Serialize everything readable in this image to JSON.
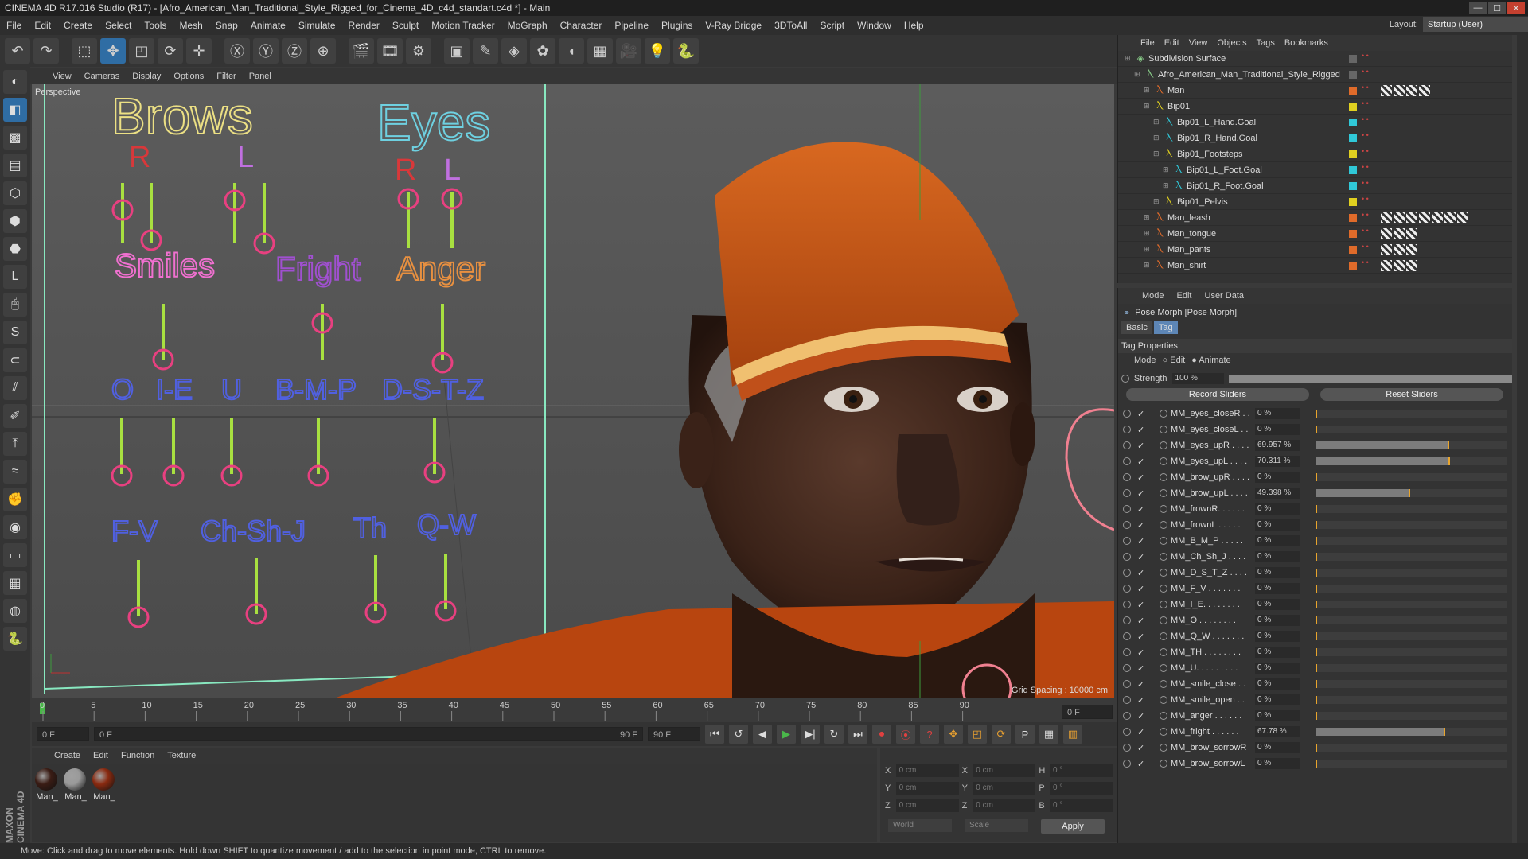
{
  "window": {
    "title": "CINEMA 4D R17.016 Studio (R17) - [Afro_American_Man_Traditional_Style_Rigged_for_Cinema_4D_c4d_standart.c4d *] - Main"
  },
  "menubar": {
    "items": [
      "File",
      "Edit",
      "Create",
      "Select",
      "Tools",
      "Mesh",
      "Snap",
      "Animate",
      "Simulate",
      "Render",
      "Sculpt",
      "Motion Tracker",
      "MoGraph",
      "Character",
      "Pipeline",
      "Plugins",
      "V-Ray Bridge",
      "3DToAll",
      "Script",
      "Window",
      "Help"
    ],
    "layout_label": "Layout:",
    "layout_value": "Startup (User)"
  },
  "viewport": {
    "menu": [
      "View",
      "Cameras",
      "Display",
      "Options",
      "Filter",
      "Panel"
    ],
    "label": "Perspective",
    "grid_spacing": "Grid Spacing : 10000 cm",
    "rig_labels": {
      "brows": "Brows",
      "eyes": "Eyes",
      "brow_r": "R",
      "brow_l": "L",
      "eye_r": "R",
      "eye_l": "L",
      "smiles": "Smiles",
      "fright": "Fright",
      "anger": "Anger",
      "o": "O",
      "ie": "I-E",
      "u": "U",
      "bmp": "B-M-P",
      "dstz": "D-S-T-Z",
      "fv": "F-V",
      "chshj": "Ch-Sh-J",
      "th": "Th",
      "qw": "Q-W"
    }
  },
  "timeline": {
    "ticks": [
      "0",
      "5",
      "10",
      "15",
      "20",
      "25",
      "30",
      "35",
      "40",
      "45",
      "50",
      "55",
      "60",
      "65",
      "70",
      "75",
      "80",
      "85",
      "90"
    ],
    "current_frame": "0 F",
    "start": "0 F",
    "min": "0 F",
    "max": "90 F",
    "end": "90 F"
  },
  "material_manager": {
    "menu": [
      "Create",
      "Edit",
      "Function",
      "Texture"
    ],
    "materials": [
      {
        "label": "Man_",
        "color": "#3a1c14"
      },
      {
        "label": "Man_",
        "color": "#9a9a9a"
      },
      {
        "label": "Man_",
        "color": "#8a2a10"
      }
    ]
  },
  "coords": {
    "rows": [
      {
        "a": "X",
        "av": "0 cm",
        "b": "X",
        "bv": "0 cm",
        "c": "H",
        "cv": "0 °"
      },
      {
        "a": "Y",
        "av": "0 cm",
        "b": "Y",
        "bv": "0 cm",
        "c": "P",
        "cv": "0 °"
      },
      {
        "a": "Z",
        "av": "0 cm",
        "b": "Z",
        "bv": "0 cm",
        "c": "B",
        "cv": "0 °"
      }
    ],
    "space": "World",
    "mode": "Scale",
    "apply": "Apply"
  },
  "object_manager": {
    "menu": [
      "File",
      "Edit",
      "View",
      "Objects",
      "Tags",
      "Bookmarks"
    ],
    "rows": [
      {
        "name": "Subdivision Surface",
        "indent": 0,
        "color": "",
        "tags": 0
      },
      {
        "name": "Afro_American_Man_Traditional_Style_Rigged",
        "indent": 1,
        "color": "",
        "tags": 0
      },
      {
        "name": "Man",
        "indent": 2,
        "color": "#e06b2a",
        "tags": 4
      },
      {
        "name": "Bip01",
        "indent": 2,
        "color": "#e0d020",
        "tags": 0
      },
      {
        "name": "Bip01_L_Hand.Goal",
        "indent": 3,
        "color": "#30c8d8",
        "tags": 0
      },
      {
        "name": "Bip01_R_Hand.Goal",
        "indent": 3,
        "color": "#30c8d8",
        "tags": 0
      },
      {
        "name": "Bip01_Footsteps",
        "indent": 3,
        "color": "#e0d020",
        "tags": 0
      },
      {
        "name": "Bip01_L_Foot.Goal",
        "indent": 4,
        "color": "#30c8d8",
        "tags": 0
      },
      {
        "name": "Bip01_R_Foot.Goal",
        "indent": 4,
        "color": "#30c8d8",
        "tags": 0
      },
      {
        "name": "Bip01_Pelvis",
        "indent": 3,
        "color": "#e0d020",
        "tags": 0
      },
      {
        "name": "Man_leash",
        "indent": 2,
        "color": "#e06b2a",
        "tags": 7
      },
      {
        "name": "Man_tongue",
        "indent": 2,
        "color": "#e06b2a",
        "tags": 3
      },
      {
        "name": "Man_pants",
        "indent": 2,
        "color": "#e06b2a",
        "tags": 3
      },
      {
        "name": "Man_shirt",
        "indent": 2,
        "color": "#e06b2a",
        "tags": 3
      }
    ]
  },
  "attributes": {
    "menu": [
      "Mode",
      "Edit",
      "User Data"
    ],
    "title": "Pose Morph [Pose Morph]",
    "tabs": [
      "Basic",
      "Tag"
    ],
    "section": "Tag Properties",
    "mode_label": "Mode",
    "mode_edit": "Edit",
    "mode_animate": "Animate",
    "strength_label": "Strength",
    "strength_value": "100 %",
    "strength_fraction": 1.0,
    "record_sliders": "Record Sliders",
    "reset_sliders": "Reset Sliders",
    "sliders": [
      {
        "name": "MM_eyes_closeR . .",
        "value": "0 %",
        "pct": 0
      },
      {
        "name": "MM_eyes_closeL . .",
        "value": "0 %",
        "pct": 0
      },
      {
        "name": "MM_eyes_upR . . . .",
        "value": "69.957 %",
        "pct": 69.957
      },
      {
        "name": "MM_eyes_upL . . . .",
        "value": "70.311 %",
        "pct": 70.311
      },
      {
        "name": "MM_brow_upR . . . .",
        "value": "0 %",
        "pct": 0
      },
      {
        "name": "MM_brow_upL . . . .",
        "value": "49.398 %",
        "pct": 49.398
      },
      {
        "name": "MM_frownR. . . . . .",
        "value": "0 %",
        "pct": 0
      },
      {
        "name": "MM_frownL . . . . .",
        "value": "0 %",
        "pct": 0
      },
      {
        "name": "MM_B_M_P . . . . .",
        "value": "0 %",
        "pct": 0
      },
      {
        "name": "MM_Ch_Sh_J . . . .",
        "value": "0 %",
        "pct": 0
      },
      {
        "name": "MM_D_S_T_Z . . . .",
        "value": "0 %",
        "pct": 0
      },
      {
        "name": "MM_F_V . . . . . . .",
        "value": "0 %",
        "pct": 0
      },
      {
        "name": "MM_I_E. . . . . . . .",
        "value": "0 %",
        "pct": 0
      },
      {
        "name": "MM_O . . . . . . . .",
        "value": "0 %",
        "pct": 0
      },
      {
        "name": "MM_Q_W . . . . . . .",
        "value": "0 %",
        "pct": 0
      },
      {
        "name": "MM_TH . . . . . . . .",
        "value": "0 %",
        "pct": 0
      },
      {
        "name": "MM_U. . . . . . . . .",
        "value": "0 %",
        "pct": 0
      },
      {
        "name": "MM_smile_close . .",
        "value": "0 %",
        "pct": 0
      },
      {
        "name": "MM_smile_open . .",
        "value": "0 %",
        "pct": 0
      },
      {
        "name": "MM_anger . . . . . .",
        "value": "0 %",
        "pct": 0
      },
      {
        "name": "MM_fright . . . . . .",
        "value": "67.78 %",
        "pct": 67.78
      },
      {
        "name": "MM_brow_sorrowR",
        "value": "0 %",
        "pct": 0
      },
      {
        "name": "MM_brow_sorrowL",
        "value": "0 %",
        "pct": 0
      }
    ]
  },
  "statusbar": {
    "text": "Move: Click and drag to move elements. Hold down SHIFT to quantize movement / add to the selection in point mode, CTRL to remove."
  },
  "branding": {
    "maxon": "MAXON CINEMA 4D"
  }
}
